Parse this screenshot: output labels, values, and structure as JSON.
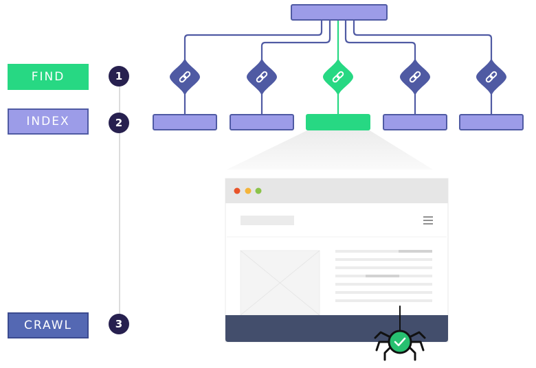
{
  "steps": [
    {
      "number": "1",
      "label": "FIND",
      "color": "#27d883",
      "border": "#27d883"
    },
    {
      "number": "2",
      "label": "INDEX",
      "color": "#9c9ce8",
      "border": "#4f5aa3"
    },
    {
      "number": "3",
      "label": "CRAWL",
      "color": "#5468b3",
      "border": "#3b4a8f"
    }
  ],
  "tree": {
    "root_color": "#9c9ce8",
    "link_color": "#4f5aa3",
    "active_color": "#27d883",
    "active_index": 2,
    "children_count": 5,
    "node_icon": "link-icon"
  },
  "browser": {
    "window_dots": [
      "#e8542a",
      "#f4b43a",
      "#8bc34a"
    ],
    "menu_icon": "hamburger-icon",
    "footer_color": "#434e6c",
    "image_placeholder": "image-placeholder-icon"
  },
  "crawler": {
    "icon": "spider-icon",
    "badge_icon": "check-icon",
    "badge_color": "#27c070"
  }
}
